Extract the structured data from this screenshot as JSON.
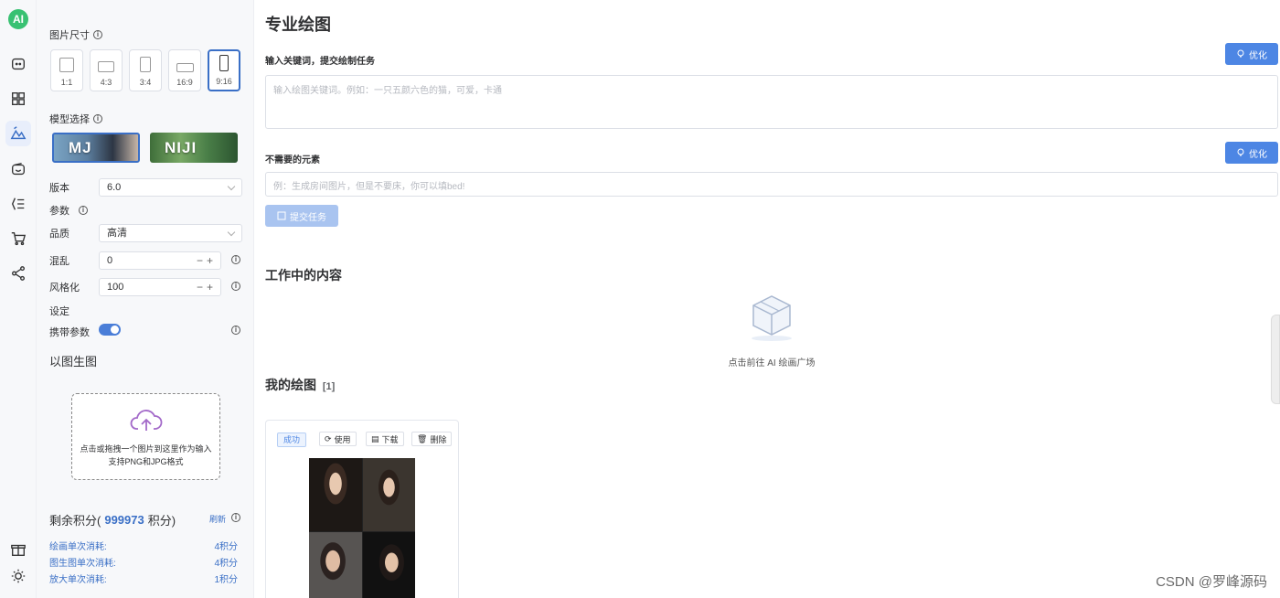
{
  "rail": {
    "logo": "AI"
  },
  "settings": {
    "image_size_label": "图片尺寸",
    "ratios": [
      "1:1",
      "4:3",
      "3:4",
      "16:9",
      "9:16"
    ],
    "model_label": "模型选择",
    "models": [
      "MJ",
      "NIJI"
    ],
    "version_label": "版本",
    "version_value": "6.0",
    "params_label": "参数",
    "quality_label": "品质",
    "quality_value": "高清",
    "chaos_label": "混乱",
    "chaos_value": "0",
    "stylize_label": "风格化",
    "stylize_value": "100",
    "config_label": "设定",
    "carry_params_label": "携带参数",
    "img2img_title": "以图生图",
    "upload_line1": "点击或拖拽一个图片到这里作为输入",
    "upload_line2": "支持PNG和JPG格式",
    "points_prefix": "剩余积分(",
    "points_value": "999973",
    "points_suffix": " 积分)",
    "refresh_label": "刷新",
    "costs": [
      {
        "label": "绘画单次消耗:",
        "value": "4积分"
      },
      {
        "label": "图生图单次消耗:",
        "value": "4积分"
      },
      {
        "label": "放大单次消耗:",
        "value": "1积分"
      }
    ]
  },
  "main": {
    "title": "专业绘图",
    "prompt_label": "输入关键词，提交绘制任务",
    "optimize_label": "优化",
    "prompt_placeholder": "输入绘图关键词。例如：一只五颜六色的猫，可爱，卡通",
    "negative_label": "不需要的元素",
    "negative_placeholder": "例：生成房间图片，但是不要床，你可以填bed!",
    "submit_label": "提交任务",
    "working_title": "工作中的内容",
    "empty_text": "点击前往 AI 绘画广场",
    "my_drawings_title": "我的绘图",
    "my_drawings_count": "[1]",
    "card": {
      "status": "成功",
      "use_label": "使用",
      "download_label": "下载",
      "delete_label": "删除"
    }
  },
  "watermark": "CSDN @罗峰源码",
  "colors": {
    "accent": "#4d86e4",
    "active_border": "#3a6fc6",
    "logo_bg": "#38c172"
  }
}
